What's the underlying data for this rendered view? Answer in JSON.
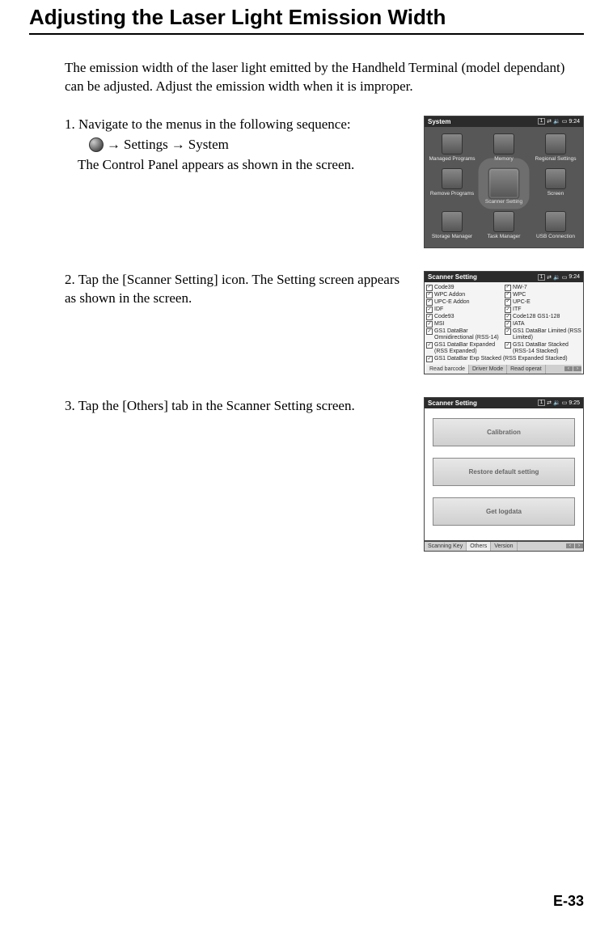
{
  "title": "Adjusting the Laser Light Emission Width",
  "intro": "The emission width of the laser light emitted by the Handheld Terminal (model dependant) can be adjusted. Adjust the emission width when it is improper.",
  "steps": {
    "s1_num": "1.",
    "s1_text": "Navigate to the menus in the following sequence:",
    "s1_nav_a": "Settings",
    "s1_nav_b": "System",
    "s1_after": "The Control Panel appears as shown in the screen.",
    "s2_num": "2.",
    "s2_text": "Tap the [Scanner Setting] icon. The Setting screen appears as shown in the screen.",
    "s3_num": "3.",
    "s3_text": "Tap the [Others] tab in the Scanner Setting screen."
  },
  "shot1": {
    "title": "System",
    "time": "9:24",
    "status_badge": "1",
    "items": [
      "Managed Programs",
      "Memory",
      "Regional Settings",
      "Remove Programs",
      "Scanner Setting",
      "Screen",
      "Storage Manager",
      "Task Manager",
      "USB Connection"
    ]
  },
  "shot2": {
    "title": "Scanner Setting",
    "time": "9:24",
    "status_badge": "1",
    "left": [
      {
        "label": "Code39",
        "on": true
      },
      {
        "label": "WPC Addon",
        "on": true
      },
      {
        "label": "UPC-E Addon",
        "on": true
      },
      {
        "label": "IDF",
        "on": true
      },
      {
        "label": "Code93",
        "on": true
      },
      {
        "label": "MSI",
        "on": true
      },
      {
        "label": "GS1 DataBar Omnidirectional (RSS-14)",
        "on": true
      },
      {
        "label": "GS1 DataBar Expanded (RSS Expanded)",
        "on": true
      }
    ],
    "right": [
      {
        "label": "NW-7",
        "on": true
      },
      {
        "label": "WPC",
        "on": true
      },
      {
        "label": "UPC-E",
        "on": true
      },
      {
        "label": "ITF",
        "on": true
      },
      {
        "label": "Code128 GS1-128",
        "on": true
      },
      {
        "label": "IATA",
        "on": true
      },
      {
        "label": "GS1 DataBar Limited (RSS Limited)",
        "on": true
      },
      {
        "label": "GS1 DataBar Stacked (RSS-14 Stacked)",
        "on": true
      }
    ],
    "full": {
      "label": "GS1 DataBar Exp Stacked (RSS Expanded Stacked)",
      "on": true
    },
    "tabs": [
      "Read barcode",
      "Driver Mode",
      "Read operat"
    ]
  },
  "shot3": {
    "title": "Scanner Setting",
    "time": "9:25",
    "status_badge": "1",
    "buttons": [
      "Calibration",
      "Restore default setting",
      "Get logdata"
    ],
    "tabs": [
      "Scanning Key",
      "Others",
      "Version"
    ]
  },
  "arrow": "→",
  "page_number": "E-33"
}
